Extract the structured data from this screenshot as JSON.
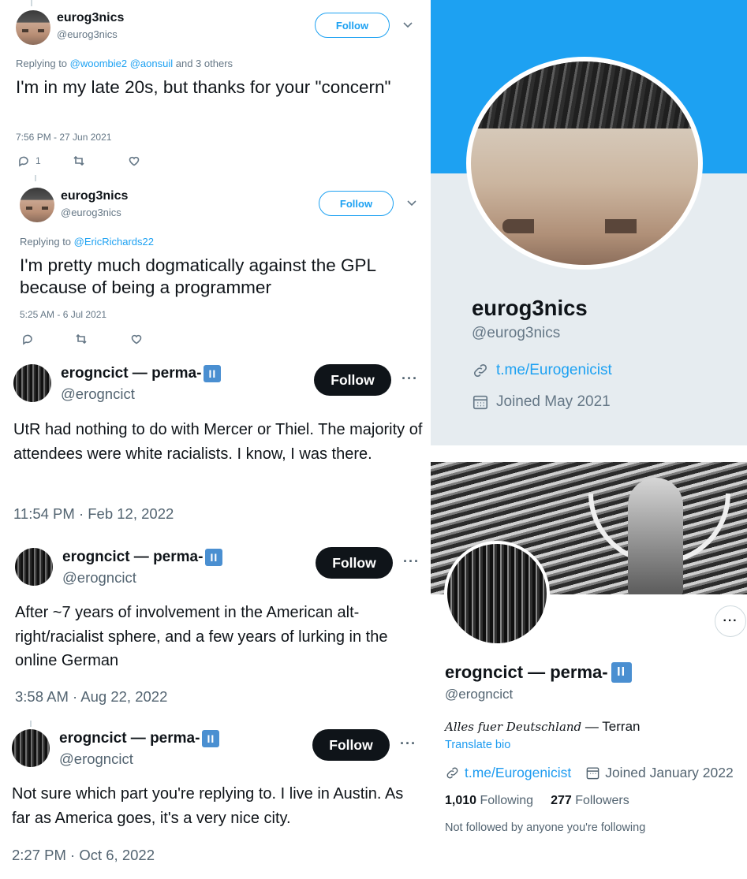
{
  "tweet1": {
    "name": "eurog3nics",
    "handle": "@eurog3nics",
    "follow_label": "Follow",
    "reply_prefix": "Replying to ",
    "reply_to_1": "@woombie2",
    "reply_to_2": "@aonsuil",
    "reply_suffix": " and 3 others",
    "text": "I'm in my late 20s, but thanks for your \"concern\"",
    "time": "7:56 PM - 27 Jun 2021",
    "reply_count": "1"
  },
  "tweet2": {
    "name": "eurog3nics",
    "handle": "@eurog3nics",
    "follow_label": "Follow",
    "reply_prefix": "Replying to ",
    "reply_to_1": "@EricRichards22",
    "text": "I'm pretty much dogmatically against the GPL because of being a programmer",
    "time": "5:25 AM - 6 Jul 2021"
  },
  "tweet3": {
    "name": "erogncict — perma-",
    "badge": "II",
    "handle": "@erogncict",
    "follow_label": "Follow",
    "text": "UtR had nothing to do with Mercer or Thiel. The majority of attendees were white racialists. I know, I was there.",
    "time": "11:54 PM · Feb 12, 2022"
  },
  "tweet4": {
    "name": "erogncict — perma-",
    "badge": "II",
    "handle": "@erogncict",
    "follow_label": "Follow",
    "text": "After ~7 years of involvement in the American alt-right/racialist sphere, and a few years of lurking in the online German",
    "time": "3:58 AM · Aug 22, 2022"
  },
  "tweet5": {
    "name": "erogncict — perma-",
    "badge": "II",
    "handle": "@erogncict",
    "follow_label": "Follow",
    "text": "Not sure which part you're replying to. I live in Austin. As far as America goes, it's a very nice city.",
    "time": "2:27 PM · Oct 6, 2022"
  },
  "profile1": {
    "name": "eurog3nics",
    "handle": "@eurog3nics",
    "link": "t.me/Eurogenicist",
    "joined": "Joined May 2021"
  },
  "profile2": {
    "name": "erogncict — perma-",
    "badge": "II",
    "handle": "@erogncict",
    "bio_fraktur": "Alles fuer Deutschland",
    "bio_rest": " — Terran",
    "translate": "Translate bio",
    "link": "t.me/Eurogenicist",
    "joined": "Joined January 2022",
    "following_count": "1,010",
    "following_label": " Following",
    "followers_count": "277",
    "followers_label": " Followers",
    "note": "Not followed by anyone you're following"
  },
  "colors": {
    "twitter_blue": "#1da1f2",
    "link_blue": "#1d9bf0",
    "badge_blue": "#4a8fd1",
    "follow_dark": "#0f1419"
  },
  "icons": [
    "reply-icon",
    "retweet-icon",
    "like-icon",
    "link-icon",
    "calendar-icon",
    "chevron-down-icon",
    "more-icon"
  ]
}
